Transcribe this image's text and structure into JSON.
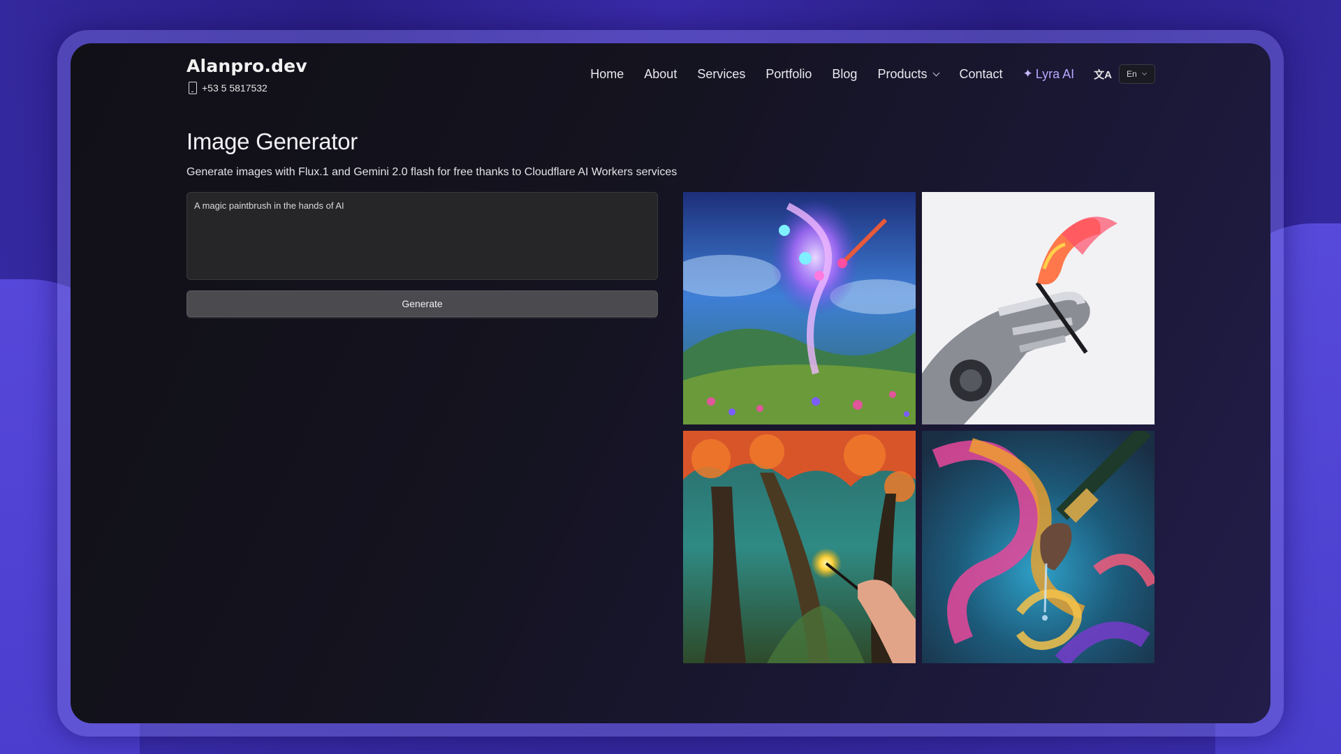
{
  "brand": {
    "title": "Alanpro.dev",
    "phone": "+53 5 5817532",
    "phone_icon": "phone-icon"
  },
  "nav": {
    "items": [
      "Home",
      "About",
      "Services",
      "Portfolio",
      "Blog",
      "Products",
      "Contact"
    ],
    "products_has_dropdown": true,
    "lyra": {
      "label": "Lyra AI",
      "icon": "sparkle-icon",
      "color": "#b9a8ff"
    },
    "language": {
      "icon": "translate-icon",
      "selected": "En"
    }
  },
  "main": {
    "title": "Image Generator",
    "subtitle": "Generate images with Flux.1 and Gemini 2.0 flash for free thanks to Cloudflare AI Workers services",
    "prompt_value": "A magic paintbrush in the hands of AI",
    "generate_label": "Generate"
  },
  "gallery": {
    "images": [
      {
        "name": "generated-image-cosmic-creature",
        "subject": "glowing cosmic creature holding a paintbrush over a flower meadow"
      },
      {
        "name": "generated-image-robot-hand",
        "subject": "robotic hand holding a paintbrush with colorful flame"
      },
      {
        "name": "generated-image-autumn-forest",
        "subject": "hand painting a glowing spark in an autumn forest"
      },
      {
        "name": "generated-image-paint-swirl",
        "subject": "paintbrush dripping paint into colorful swirl"
      }
    ]
  },
  "theme": {
    "accent": "#b9a8ff",
    "page_bg": "#2a1f86",
    "window_bg": "#14131f"
  }
}
